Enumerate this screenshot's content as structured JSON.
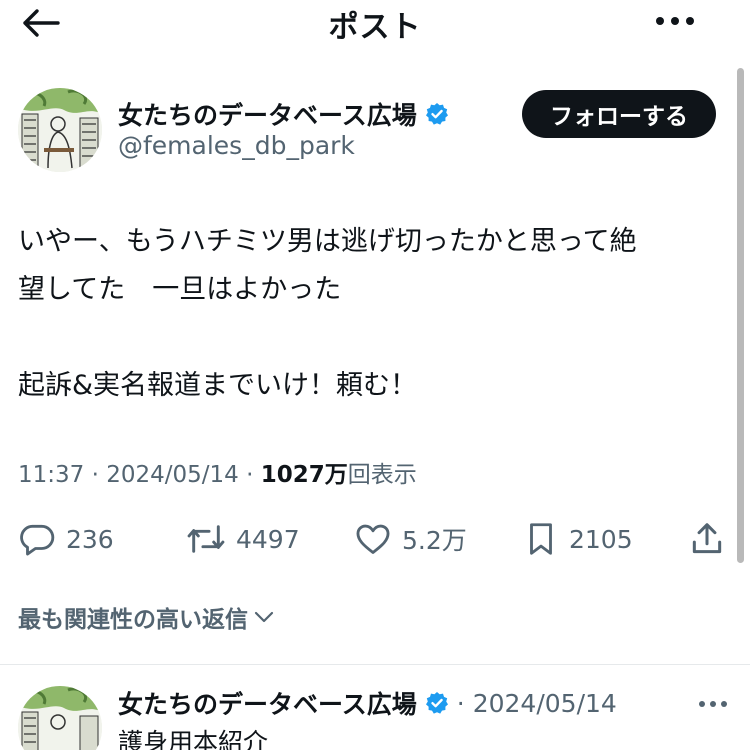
{
  "header": {
    "title": "ポスト",
    "back_icon": "arrow-left-icon",
    "more_icon": "more-horizontal-icon"
  },
  "post": {
    "author_name": "女たちのデータベース広場",
    "handle": "@females_db_park",
    "verified": true,
    "follow_label": "フォローする",
    "text": "いやー、もうハチミツ男は逃げ切ったかと思って絶\n望してた　一旦はよかった\n\n起訴&実名報道までいけ！頼む！",
    "time": "11:37",
    "separator": "·",
    "date": "2024/05/14",
    "views_count": "1027万",
    "views_label": "回表示"
  },
  "actions": {
    "replies": "236",
    "reposts": "4497",
    "likes": "5.2万",
    "bookmarks": "2105"
  },
  "replies_section": {
    "sort_label": "最も関連性の高い返信"
  },
  "reply": {
    "author_name": "女たちのデータベース広場",
    "separator": "·",
    "date": "2024/05/14",
    "text": "護身用本紹介"
  },
  "colors": {
    "text": "#0f1419",
    "muted": "#536471",
    "verified": "#1d9bf0",
    "button_bg": "#0f1419"
  }
}
